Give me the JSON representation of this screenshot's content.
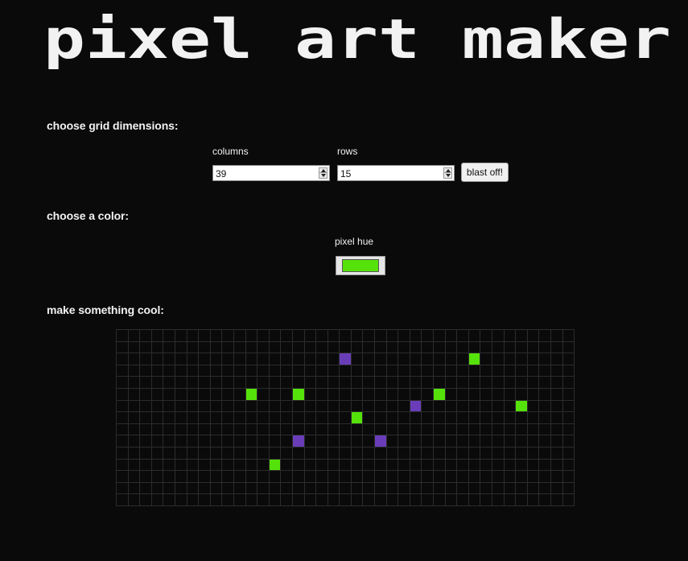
{
  "page": {
    "title": "pixel art maker",
    "background": "#0a0a0a"
  },
  "sections": {
    "dimensions_heading": "choose grid dimensions:",
    "color_heading": "choose a color:",
    "canvas_heading": "make something cool:"
  },
  "grid_form": {
    "columns_label": "columns",
    "columns_value": "39",
    "rows_label": "rows",
    "rows_value": "15",
    "submit_label": "blast off!"
  },
  "color_form": {
    "label": "pixel hue",
    "value": "#55e10a"
  },
  "canvas": {
    "columns": 39,
    "rows": 15,
    "line_color": "#2c2c2c",
    "filled_cells": [
      {
        "row": 2,
        "col": 19,
        "color": "#6a3db8"
      },
      {
        "row": 2,
        "col": 30,
        "color": "#55e10a"
      },
      {
        "row": 5,
        "col": 11,
        "color": "#55e10a"
      },
      {
        "row": 5,
        "col": 15,
        "color": "#55e10a"
      },
      {
        "row": 5,
        "col": 27,
        "color": "#55e10a"
      },
      {
        "row": 6,
        "col": 25,
        "color": "#6a3db8"
      },
      {
        "row": 6,
        "col": 34,
        "color": "#55e10a"
      },
      {
        "row": 7,
        "col": 20,
        "color": "#55e10a"
      },
      {
        "row": 9,
        "col": 15,
        "color": "#6a3db8"
      },
      {
        "row": 9,
        "col": 22,
        "color": "#6a3db8"
      },
      {
        "row": 11,
        "col": 13,
        "color": "#55e10a"
      }
    ]
  }
}
